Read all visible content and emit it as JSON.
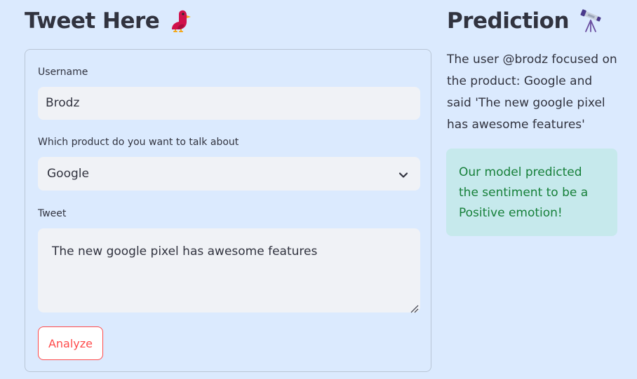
{
  "left": {
    "heading": "Tweet Here",
    "heading_icon": "bird-icon",
    "username": {
      "label": "Username",
      "value": "Brodz"
    },
    "product": {
      "label": "Which product do you want to talk about",
      "selected": "Google"
    },
    "tweet": {
      "label": "Tweet",
      "value": "The new google pixel has awesome features"
    },
    "analyze_label": "Analyze"
  },
  "right": {
    "heading": "Prediction",
    "heading_icon": "telescope-icon",
    "summary": "The user @brodz focused on the product: Google and said 'The new google pixel has awesome features'",
    "result": "Our model predicted the sentiment to be a Positive emotion!"
  },
  "colors": {
    "background": "#dbeafe",
    "accent": "#ff4b4b",
    "field_background": "#f0f2f6",
    "success_background": "#c6e9ec",
    "success_text": "#17803a",
    "text": "#31333f"
  }
}
